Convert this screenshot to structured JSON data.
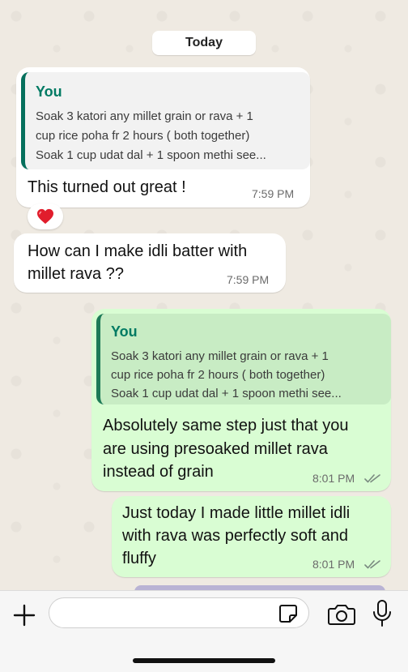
{
  "date_divider": "Today",
  "messages": [
    {
      "quote": {
        "author": "You",
        "lines": [
          "Soak 3 katori any millet grain or rava + 1",
          "cup rice poha fr 2 hours ( both together)",
          "Soak 1 cup udat dal + 1 spoon methi see..."
        ]
      },
      "lines": [
        "This turned out great !"
      ],
      "time": "7:59 PM",
      "reaction": "❤️"
    },
    {
      "lines": [
        "How can I make idli batter with",
        "millet rava ??"
      ],
      "time": "7:59 PM"
    },
    {
      "quote": {
        "author": "You",
        "lines": [
          "Soak 3 katori any millet grain or rava + 1",
          "cup rice poha fr 2 hours ( both together)",
          "Soak 1 cup udat dal + 1 spoon methi see..."
        ]
      },
      "lines": [
        "Absolutely same step just that you",
        "are using presoaked millet rava",
        "instead of grain"
      ],
      "time": "8:01 PM",
      "status": "read"
    },
    {
      "lines": [
        "Just today I made little millet idli",
        "with rava was perfectly soft and",
        "fluffy"
      ],
      "time": "8:01 PM",
      "status": "read"
    }
  ],
  "composer": {
    "value": "",
    "placeholder": ""
  },
  "icons": {
    "attach": "plus-icon",
    "sticker": "sticker-icon",
    "camera": "camera-icon",
    "mic": "microphone-icon",
    "read_receipt": "double-check-icon"
  },
  "colors": {
    "chat_background": "#efeae2",
    "incoming_bubble": "#ffffff",
    "outgoing_bubble": "#d9fdd3",
    "quote_author": "#007a63",
    "quote_bar": "#06705d"
  }
}
